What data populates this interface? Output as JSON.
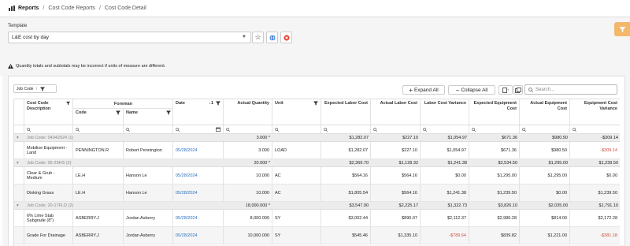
{
  "breadcrumb": {
    "root": "Reports",
    "level2": "Cost Code Reports",
    "level3": "Cost Code Detail"
  },
  "template": {
    "label": "Template",
    "value": "L&E cost by day"
  },
  "warning": "Quantity totals and subtotals may be incorrect if units of measure are different.",
  "toolbar": {
    "group_chip": "Job Code",
    "group_sort": "↑",
    "expand_all": "Expand All",
    "collapse_all": "Collapse All",
    "search_placeholder": "Search..."
  },
  "columns": {
    "cost_code_desc": "Cost Code Description",
    "foreman": "Foreman",
    "code": "Code",
    "name": "Name",
    "date": "Date",
    "date_sort": "↓1",
    "actual_qty": "Actual Quantity",
    "unit": "Unit",
    "exp_labor": "Expected Labor Cost",
    "act_labor": "Actual Labor Cost",
    "labor_var": "Labor Cost Variance",
    "exp_equip": "Expected Equipment Cost",
    "act_equip": "Actual Equipment Cost",
    "equip_var": "Equipment Cost Variance"
  },
  "groups": [
    {
      "label": "Job Code: 04042024 (1)",
      "qty": "3.000 *",
      "exp_labor": "$1,282.07",
      "act_labor": "$227.10",
      "labor_var": "$1,054.97",
      "exp_equip": "$671.36",
      "act_equip": "$980.50",
      "equip_var": "-$309.14"
    },
    {
      "label": "Job Code: 05-29HS (2)",
      "qty": "20.000 *",
      "exp_labor": "$2,369.70",
      "act_labor": "$1,128.32",
      "labor_var": "$1,241.38",
      "exp_equip": "$2,534.50",
      "act_equip": "$1,295.00",
      "equip_var": "$1,239.50"
    },
    {
      "label": "Job Code: 20-17FLD (2)",
      "qty": "18,000.000 *",
      "exp_labor": "$3,547.90",
      "act_labor": "$2,225.17",
      "labor_var": "$1,322.73",
      "exp_equip": "$3,826.10",
      "act_equip": "$2,035.00",
      "equip_var": "$1,791.10"
    }
  ],
  "rows": [
    {
      "desc": "Mobilize Equipment - Land",
      "code": "PENNINGTON.R",
      "name": "Robert Pennington",
      "date": "05/28/2024",
      "qty": "3.000",
      "unit": "LOAD",
      "exp_labor": "$1,282.07",
      "act_labor": "$227.10",
      "labor_var": "$1,054.97",
      "exp_equip": "$671.36",
      "act_equip": "$980.50",
      "equip_var": "-$309.14"
    },
    {
      "desc": "Clear & Grub - Medium",
      "code": "LE.H",
      "name": "Hanson Le",
      "date": "05/28/2024",
      "qty": "10.000",
      "unit": "AC",
      "exp_labor": "$564.16",
      "act_labor": "$564.16",
      "labor_var": "$0.00",
      "exp_equip": "$1,295.00",
      "act_equip": "$1,295.00",
      "equip_var": "$0.00"
    },
    {
      "desc": "Disking Grass",
      "code": "LE.H",
      "name": "Hanson Le",
      "date": "05/28/2024",
      "qty": "10.000",
      "unit": "AC",
      "exp_labor": "$1,805.54",
      "act_labor": "$564.16",
      "labor_var": "$1,241.38",
      "exp_equip": "$1,239.50",
      "act_equip": "$0.00",
      "equip_var": "$1,239.50"
    },
    {
      "desc": "6% Lime Stab Subgrade (8\")",
      "code": "ASBERRY.J",
      "name": "Jordan Asberry",
      "date": "05/28/2024",
      "qty": "8,000.000",
      "unit": "SY",
      "exp_labor": "$3,002.44",
      "act_labor": "$890.07",
      "labor_var": "$2,112.37",
      "exp_equip": "$2,986.28",
      "act_equip": "$814.00",
      "equip_var": "$2,172.28"
    },
    {
      "desc": "Grade For Drainage",
      "code": "ASBERRY.J",
      "name": "Jordan Asberry",
      "date": "05/28/2024",
      "qty": "10,000.000",
      "unit": "SY",
      "exp_labor": "$545.46",
      "act_labor": "$1,335.10",
      "labor_var": "-$789.64",
      "exp_equip": "$839.82",
      "act_equip": "$1,221.00",
      "equip_var": "-$381.18"
    }
  ],
  "colors": {
    "accent_link": "#2a70c0",
    "negative": "#d14a3a",
    "filter_badge": "#f4b86b"
  }
}
